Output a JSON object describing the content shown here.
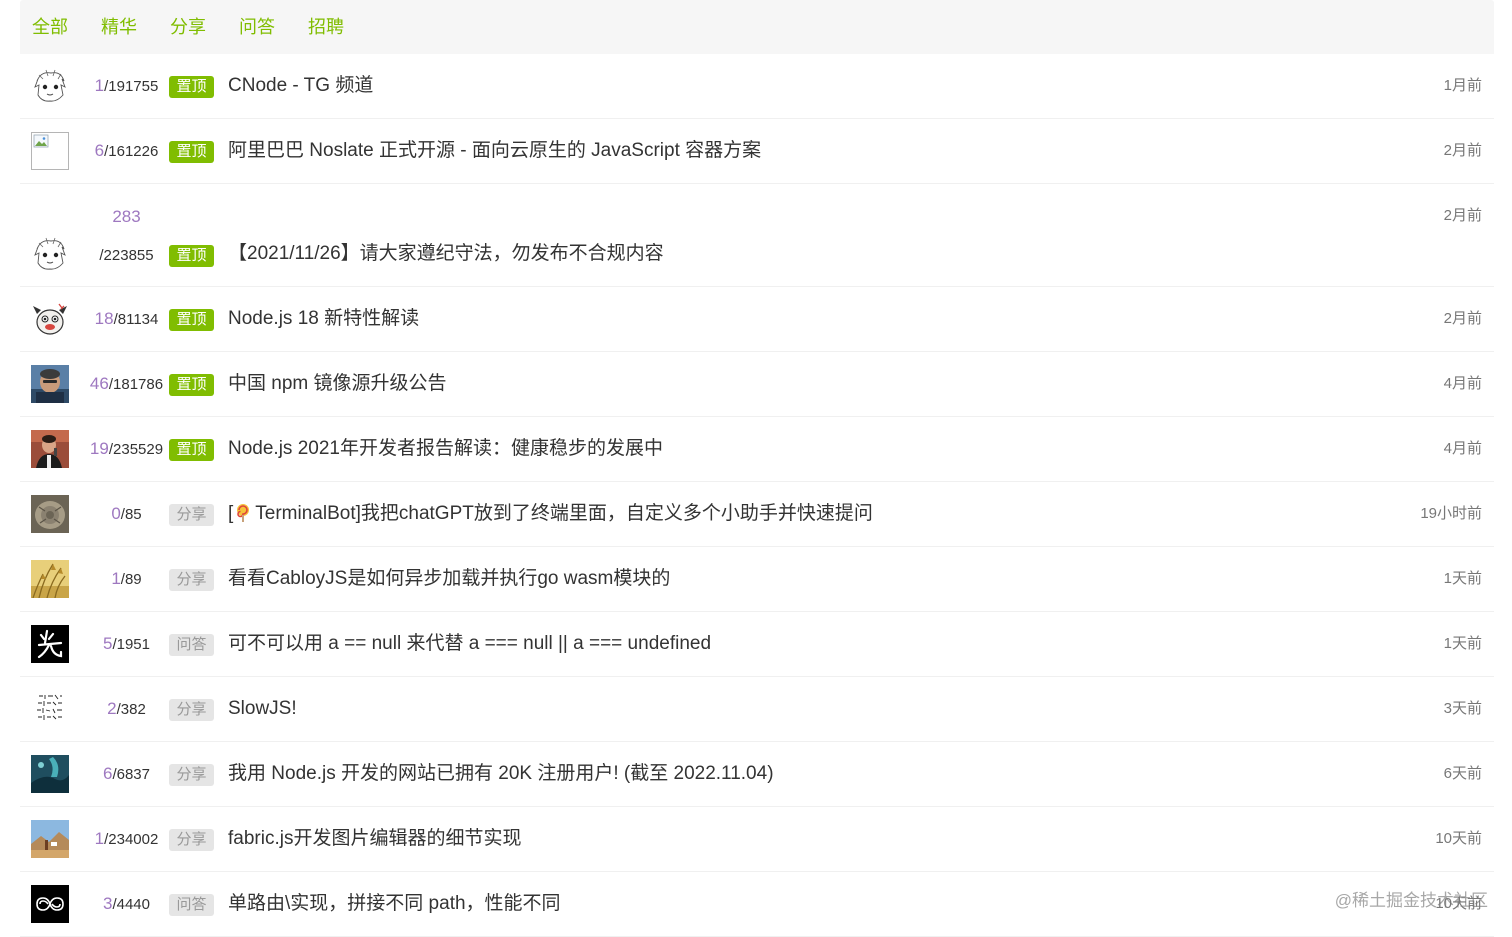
{
  "tabs": [
    "全部",
    "精华",
    "分享",
    "问答",
    "招聘"
  ],
  "topics": [
    {
      "avatar": "sketch-face-avatar",
      "replies": "1",
      "views": "/191755",
      "tag": "置顶",
      "tag_type": "top",
      "title": "CNode - TG 频道",
      "time": "1月前"
    },
    {
      "avatar": "broken-image-avatar",
      "replies": "6",
      "views": "/161226",
      "tag": "置顶",
      "tag_type": "top",
      "title": "阿里巴巴 Noslate 正式开源 - 面向云原生的 JavaScript 容器方案",
      "time": "2月前"
    },
    {
      "avatar": "sketch-face-avatar",
      "replies": "283",
      "views": "/223855",
      "tag": "置顶",
      "tag_type": "top",
      "title": "【2021/11/26】请大家遵纪守法，勿发布不合规内容",
      "time": "2月前",
      "tall": true
    },
    {
      "avatar": "cartoon-dog-avatar",
      "replies": "18",
      "views": "/81134",
      "tag": "置顶",
      "tag_type": "top",
      "title": "Node.js 18 新特性解读",
      "time": "2月前"
    },
    {
      "avatar": "person-photo-avatar",
      "replies": "46",
      "views": "/181786",
      "tag": "置顶",
      "tag_type": "top",
      "title": "中国 npm 镜像源升级公告",
      "time": "4月前"
    },
    {
      "avatar": "speaker-photo-avatar",
      "replies": "19",
      "views": "/235529",
      "tag": "置顶",
      "tag_type": "top",
      "title": "Node.js 2021年开发者报告解读：健康稳步的发展中",
      "time": "4月前"
    },
    {
      "avatar": "stone-photo-avatar",
      "replies": "0",
      "views": "/85",
      "tag": "分享",
      "tag_type": "normal",
      "title_prefix": "[",
      "title_icon": "lollipop-icon",
      "title": "TerminalBot]我把chatGPT放到了终端里面，自定义多个小助手并快速提问",
      "time": "19小时前"
    },
    {
      "avatar": "wheat-photo-avatar",
      "replies": "1",
      "views": "/89",
      "tag": "分享",
      "tag_type": "normal",
      "title": "看看CabloyJS是如何异步加载并执行go wasm模块的",
      "time": "1天前"
    },
    {
      "avatar": "calligraphy-avatar",
      "replies": "5",
      "views": "/1951",
      "tag": "问答",
      "tag_type": "normal",
      "title": "可不可以用 a == null 来代替 a === null || a === undefined",
      "time": "1天前"
    },
    {
      "avatar": "handwriting-avatar",
      "replies": "2",
      "views": "/382",
      "tag": "分享",
      "tag_type": "normal",
      "title": "SlowJS!",
      "time": "3天前"
    },
    {
      "avatar": "teal-art-avatar",
      "replies": "6",
      "views": "/6837",
      "tag": "分享",
      "tag_type": "normal",
      "title": "我用 Node.js 开发的网站已拥有 20K 注册用户! (截至 2022.11.04)",
      "time": "6天前"
    },
    {
      "avatar": "landscape-photo-avatar",
      "replies": "1",
      "views": "/234002",
      "tag": "分享",
      "tag_type": "normal",
      "title": "fabric.js开发图片编辑器的细节实现",
      "time": "10天前"
    },
    {
      "avatar": "infinity-logo-avatar",
      "replies": "3",
      "views": "/4440",
      "tag": "问答",
      "tag_type": "normal",
      "title": "单路由\\实现，拼接不同 path，性能不同",
      "time": "10天前"
    }
  ],
  "watermark": "@稀土掘金技术社区",
  "colors": {
    "accent": "#80bd01",
    "replies": "#9e78c0",
    "tab_bg": "#f6f6f6"
  }
}
